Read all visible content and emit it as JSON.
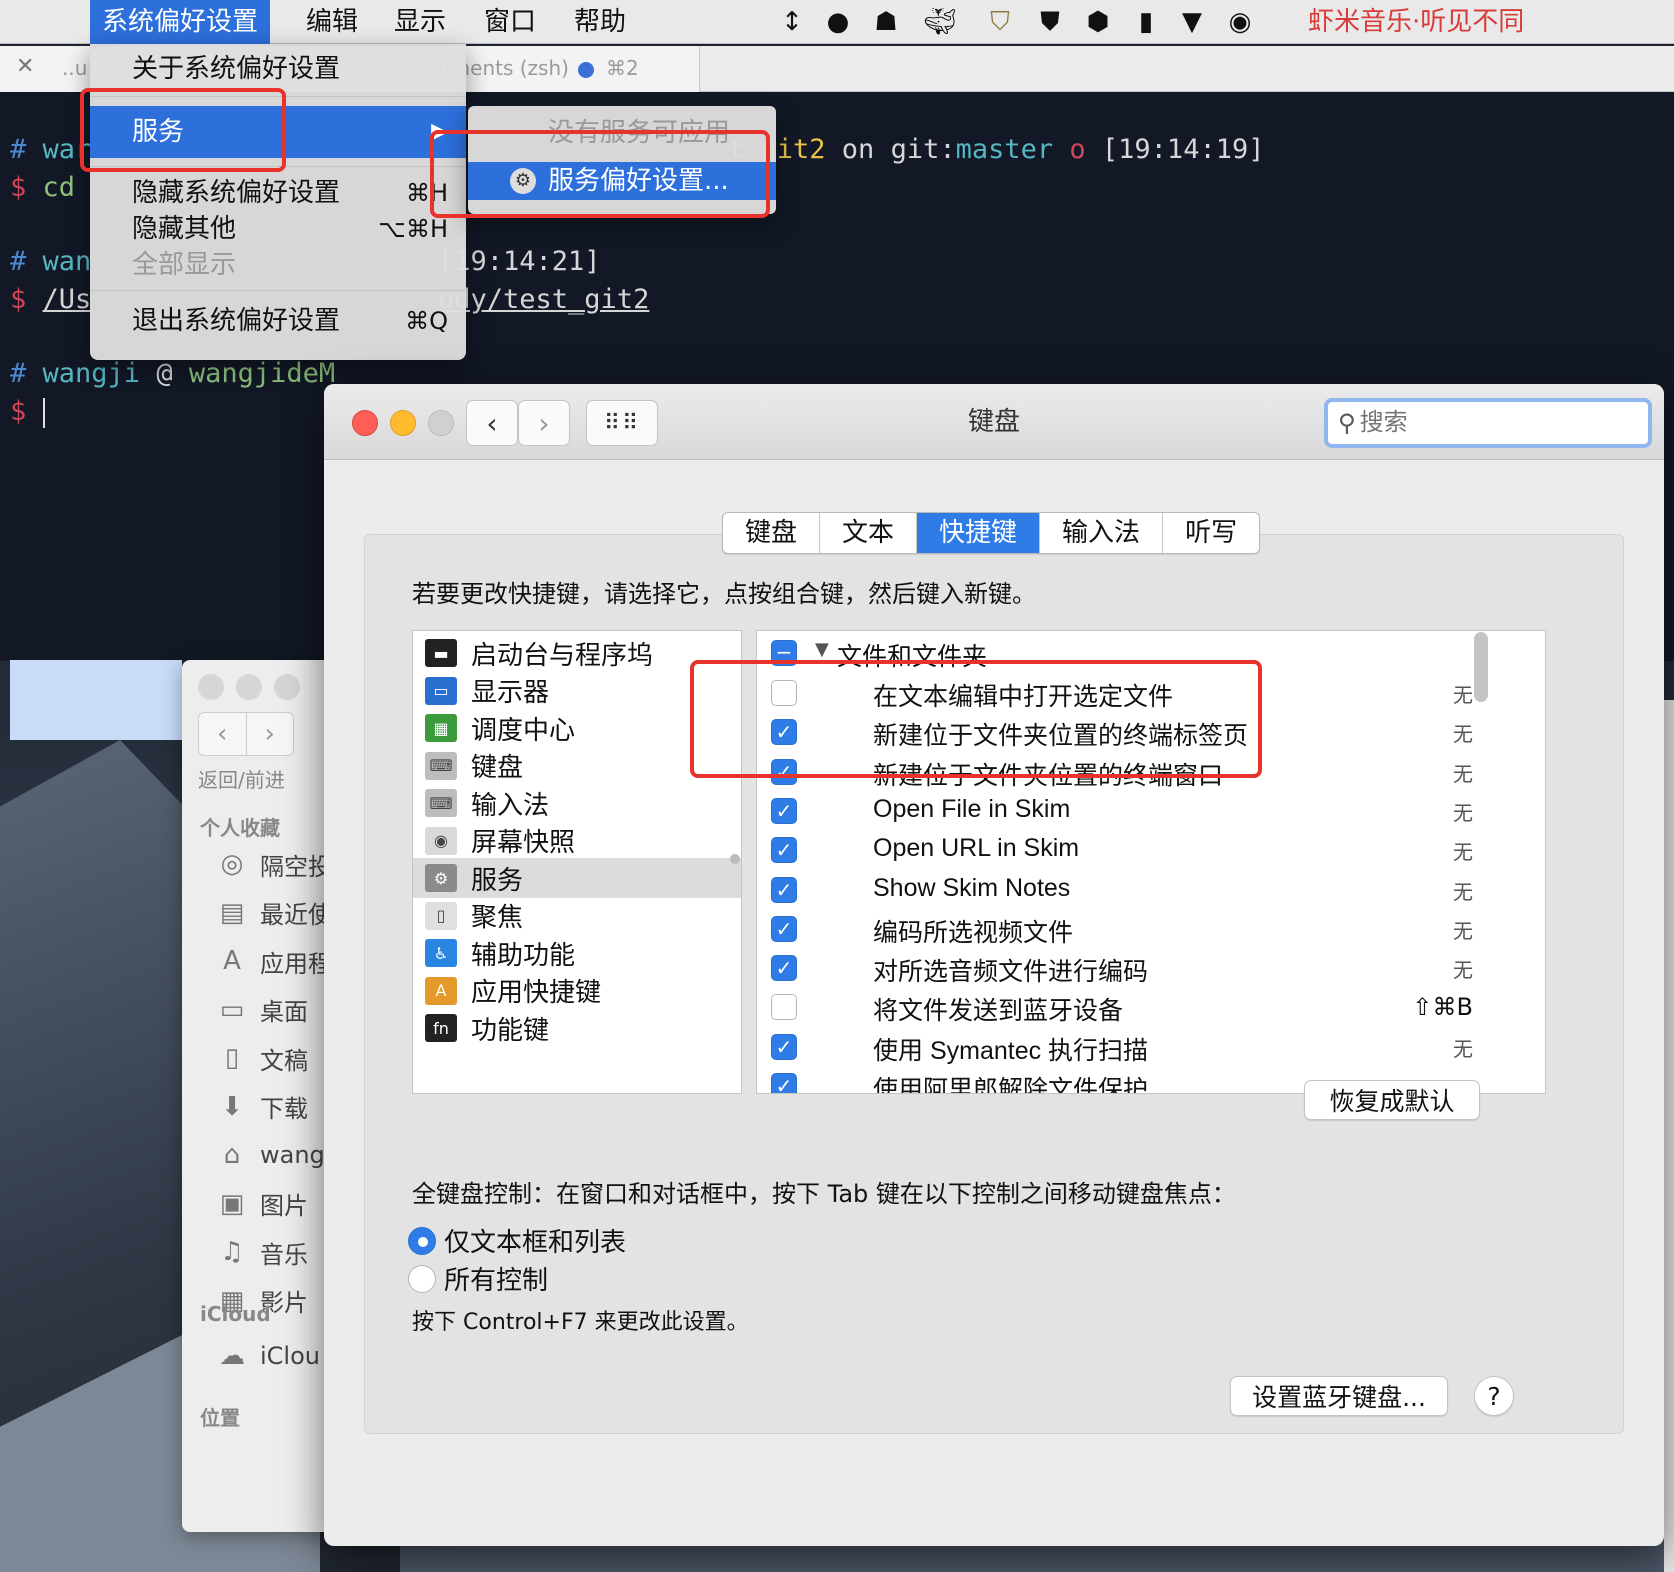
{
  "menubar": {
    "apple": "",
    "items": [
      "系统偏好设置",
      "编辑",
      "显示",
      "窗口",
      "帮助"
    ],
    "status_text": "虾米音乐·听见不同",
    "status_icons": [
      "vpn-arrows-icon",
      "cloud-droplet-icon",
      "hat-icon",
      "docker-whale-icon",
      "shield-bars-icon",
      "shield-icon",
      "hexagon-icon",
      "phone-icon",
      "v-shield-icon",
      "media-icon"
    ]
  },
  "app_menu": {
    "about": "关于系统偏好设置",
    "services": "服务",
    "hide": "隐藏系统偏好设置",
    "hide_sc": "⌘H",
    "hide_others": "隐藏其他",
    "hide_others_sc": "⌥⌘H",
    "show_all": "全部显示",
    "quit": "退出系统偏好设置",
    "quit_sc": "⌘Q",
    "services_arrow": "▶"
  },
  "submenu": {
    "none": "没有服务可应用",
    "prefs": "服务偏好设置..."
  },
  "terminal": {
    "tab_close": "✕",
    "tab_left": "..u",
    "tab_title": "uments (zsh)",
    "tab_shortcut": "⌘2",
    "lines": [
      {
        "hash": "#",
        "user": "war",
        "rest": "t_git2 on git:master o [19:14:19]"
      },
      {
        "hash": "$",
        "cmd": "cd"
      },
      {
        "hash": "#",
        "user": "wan",
        "rest": "[19:14:21]"
      },
      {
        "hash": "$",
        "cmd": "/Us",
        "rest": "udy/test_git2"
      },
      {
        "hash": "#",
        "user": "wangji",
        "at": "@",
        "host": "wangjideM"
      },
      {
        "hash": "$",
        "cmd": ""
      }
    ],
    "rest_parts": {
      "git": "t_git2",
      "on": " on git:",
      "master": "master",
      "o": " o",
      "time": " [19:14:19]"
    }
  },
  "finder": {
    "nav_label": "返回/前进",
    "section_favorites": "个人收藏",
    "favorites": [
      {
        "icon": "airdrop-icon",
        "label": "隔空投"
      },
      {
        "icon": "recents-icon",
        "label": "最近使"
      },
      {
        "icon": "applications-icon",
        "label": "应用程"
      },
      {
        "icon": "desktop-icon",
        "label": "桌面"
      },
      {
        "icon": "documents-icon",
        "label": "文稿"
      },
      {
        "icon": "downloads-icon",
        "label": "下载"
      },
      {
        "icon": "home-icon",
        "label": "wang"
      },
      {
        "icon": "pictures-icon",
        "label": "图片"
      },
      {
        "icon": "music-icon",
        "label": "音乐"
      },
      {
        "icon": "movies-icon",
        "label": "影片"
      }
    ],
    "section_icloud": "iCloud",
    "icloud_item": "iClou",
    "section_locations": "位置"
  },
  "prefs": {
    "title": "键盘",
    "search_placeholder": "搜索",
    "tabs": [
      "键盘",
      "文本",
      "快捷键",
      "输入法",
      "听写"
    ],
    "active_tab": "快捷键",
    "instruction": "若要更改快捷键，请选择它，点按组合键，然后键入新键。",
    "categories": [
      {
        "label": "启动台与程序坞",
        "icon": "launchpad-icon",
        "color": "#222"
      },
      {
        "label": "显示器",
        "icon": "display-icon",
        "color": "#2a6fcf"
      },
      {
        "label": "调度中心",
        "icon": "mission-control-icon",
        "color": "#3b9a3b"
      },
      {
        "label": "键盘",
        "icon": "keyboard-icon",
        "color": "#bdbdbd"
      },
      {
        "label": "输入法",
        "icon": "input-source-icon",
        "color": "#bdbdbd"
      },
      {
        "label": "屏幕快照",
        "icon": "screenshot-icon",
        "color": "#d9d9d9"
      },
      {
        "label": "服务",
        "icon": "services-gear-icon",
        "color": "#8a8a8a"
      },
      {
        "label": "聚焦",
        "icon": "spotlight-icon",
        "color": "#e0e0e0"
      },
      {
        "label": "辅助功能",
        "icon": "accessibility-icon",
        "color": "#2a85e2"
      },
      {
        "label": "应用快捷键",
        "icon": "app-shortcuts-icon",
        "color": "#e39a2a"
      },
      {
        "label": "功能键",
        "icon": "fn-key-icon",
        "color": "#222"
      }
    ],
    "selected_category": "服务",
    "group_label": "文件和文件夹",
    "shortcuts": [
      {
        "label": "在文本编辑中打开选定文件",
        "checked": false,
        "key": "无"
      },
      {
        "label": "新建位于文件夹位置的终端标签页",
        "checked": true,
        "key": "无"
      },
      {
        "label": "新建位于文件夹位置的终端窗口",
        "checked": true,
        "key": "无"
      },
      {
        "label": "Open File in Skim",
        "checked": true,
        "key": "无"
      },
      {
        "label": "Open URL in Skim",
        "checked": true,
        "key": "无"
      },
      {
        "label": "Show Skim Notes",
        "checked": true,
        "key": "无"
      },
      {
        "label": "编码所选视频文件",
        "checked": true,
        "key": "无"
      },
      {
        "label": "对所选音频文件进行编码",
        "checked": true,
        "key": "无"
      },
      {
        "label": "将文件发送到蓝牙设备",
        "checked": false,
        "key": "⇧⌘B"
      },
      {
        "label": "使用 Symantec 执行扫描",
        "checked": true,
        "key": "无"
      },
      {
        "label": "使用阿里郎解除文件保护",
        "checked": true,
        "key": ""
      }
    ],
    "restore_button": "恢复成默认",
    "kb_control_label": "全键盘控制：在窗口和对话框中，按下 Tab 键在以下控制之间移动键盘焦点：",
    "radio_options": [
      "仅文本框和列表",
      "所有控制"
    ],
    "radio_selected": "仅文本框和列表",
    "hint": "按下 Control+F7 来更改此设置。",
    "bluetooth_button": "设置蓝牙键盘...",
    "help_button": "?"
  },
  "colors": {
    "accent": "#2f7ce7",
    "annotation": "#e8322c",
    "xiami_red": "#d93a3a"
  }
}
